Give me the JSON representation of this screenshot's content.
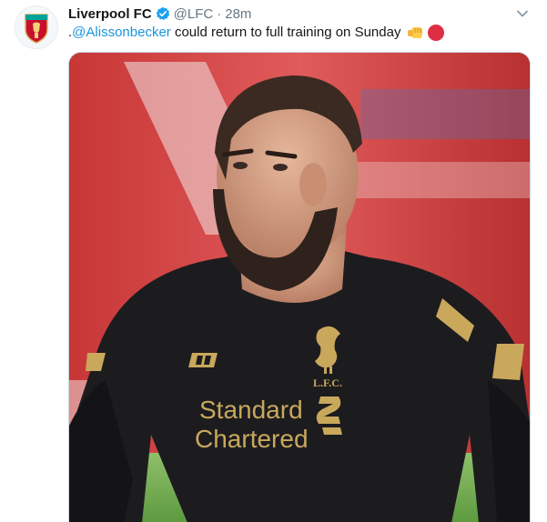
{
  "tweet": {
    "author": {
      "name": "Liverpool FC",
      "handle": "@LFC",
      "verified": true,
      "avatar_icon": "lfc-crest-icon"
    },
    "separator": "·",
    "time": "28m",
    "text": {
      "prefix": ".",
      "mention": "@Alissonbecker",
      "body": " could return to full training on Sunday",
      "emojis": [
        "fist-icon",
        "red-circle-icon"
      ]
    },
    "media": {
      "kit_sponsor_line1": "Standard",
      "kit_sponsor_line2": "Chartered",
      "kit_crest_text": "L.F.C.",
      "colors": {
        "shirt": "#1c1c1f",
        "gold": "#c9a85c",
        "stand_red": "#d63b3b"
      }
    }
  },
  "colors": {
    "link": "#1b95e0",
    "secondary_text": "#657786",
    "verified": "#1da1f2",
    "red_circle": "#dd2e44"
  }
}
